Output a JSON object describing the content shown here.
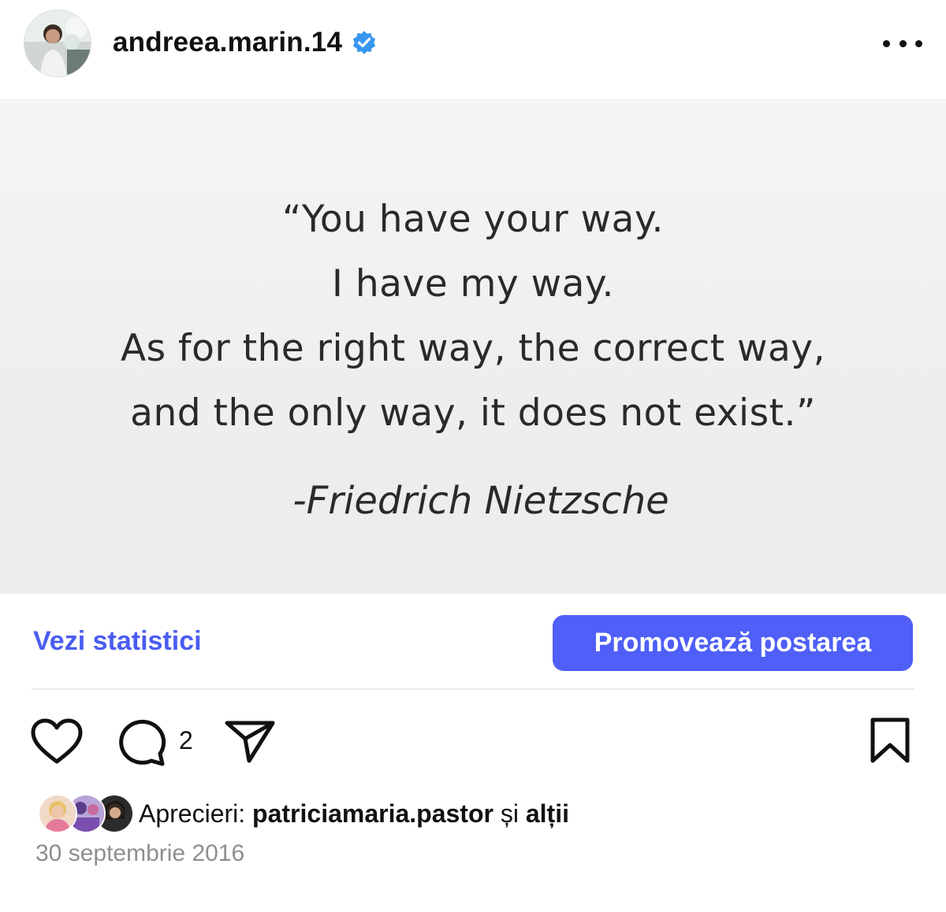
{
  "header": {
    "username": "andreea.marin.14",
    "verified": true,
    "more_icon": "more-horizontal-icon"
  },
  "post": {
    "quote_lines": [
      "“You have your way.",
      "I have my way.",
      "As for the right way, the correct way,",
      "and the only way, it does not exist.”"
    ],
    "author": "-Friedrich Nietzsche"
  },
  "insights": {
    "stats_label": "Vezi statistici",
    "promote_label": "Promovează postarea"
  },
  "actions": {
    "like_icon": "heart-icon",
    "comment_icon": "comment-icon",
    "comment_count": "2",
    "share_icon": "send-icon",
    "save_icon": "bookmark-icon"
  },
  "likes": {
    "prefix": "Aprecieri:",
    "user": "patriciamaria.pastor",
    "conjunction": "și",
    "others": "alții"
  },
  "date": "30 septembrie 2016",
  "colors": {
    "accent": "#4f5ff7",
    "link": "#4a5cf0",
    "verified": "#3897f0",
    "muted": "#8e8e8e"
  }
}
